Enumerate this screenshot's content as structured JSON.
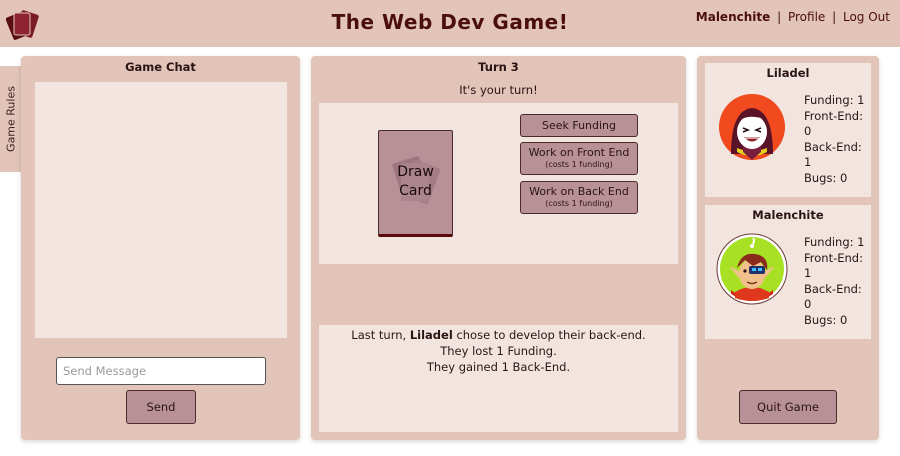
{
  "header": {
    "title": "The Web Dev Game!",
    "username": "Malenchite",
    "separator": "|",
    "profile_link": "Profile",
    "logout_link": "Log Out"
  },
  "rules_tab": {
    "label": "Game Rules"
  },
  "chat": {
    "title": "Game Chat",
    "input_placeholder": "Send Message",
    "input_value": "",
    "send_label": "Send"
  },
  "game": {
    "turn_label": "Turn 3",
    "turn_message": "It's your turn!",
    "deck_label_line1": "Draw",
    "deck_label_line2": "Card",
    "actions": {
      "seek_label": "Seek Funding",
      "front_label": "Work on Front End",
      "front_cost": "(costs 1 funding)",
      "back_label": "Work on Back End",
      "back_cost": "(costs 1 funding)"
    },
    "log": {
      "line1_prefix": "Last turn,",
      "line1_player": "Liladel",
      "line1_suffix": "chose to develop their back-end.",
      "line2": "They lost 1 Funding.",
      "line3": "They gained 1 Back-End."
    }
  },
  "players": [
    {
      "name": "Liladel",
      "stats": [
        "Funding: 1",
        "Front-End:",
        "0",
        "Back-End:",
        "1",
        "Bugs: 0"
      ],
      "avatar_icon": "player-avatar-red-hair",
      "avatar_bg": "#f04a1e"
    },
    {
      "name": "Malenchite",
      "stats": [
        "Funding: 1",
        "Front-End:",
        "1",
        "Back-End:",
        "0",
        "Bugs: 0"
      ],
      "avatar_icon": "player-avatar-green-elf",
      "avatar_bg": "#a8e024"
    }
  ],
  "quit_label": "Quit Game",
  "colors": {
    "panel": "#e2c4b8",
    "inner": "#f2e5e0",
    "button": "#b89098",
    "title_text": "#4a0e0e"
  }
}
